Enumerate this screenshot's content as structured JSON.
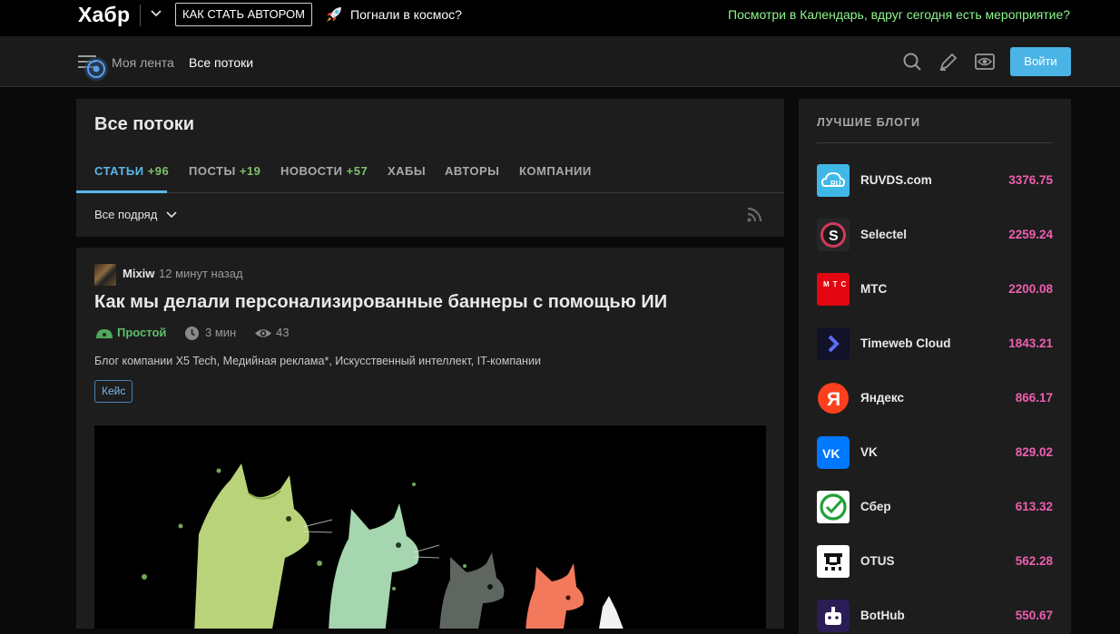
{
  "topbar": {
    "logo": "Хабр",
    "author_button": "КАК СТАТЬ АВТОРОМ",
    "space_link": "Погнали в космос?",
    "calendar_link": "Посмотри в Календарь, вдруг сегодня есть мероприятие?"
  },
  "nav": {
    "my_feed": "Моя лента",
    "all_streams": "Все потоки",
    "login": "Войти"
  },
  "page": {
    "title": "Все потоки",
    "tabs": [
      {
        "label": "СТАТЬИ",
        "count": "+96"
      },
      {
        "label": "ПОСТЫ",
        "count": "+19"
      },
      {
        "label": "НОВОСТИ",
        "count": "+57"
      },
      {
        "label": "ХАБЫ",
        "count": ""
      },
      {
        "label": "АВТОРЫ",
        "count": ""
      },
      {
        "label": "КОМПАНИИ",
        "count": ""
      }
    ],
    "filter": "Все подряд"
  },
  "article": {
    "author": "Mixiw",
    "time": "12 минут назад",
    "title": "Как мы делали персонализированные баннеры с помощью ИИ",
    "difficulty": "Простой",
    "read_time": "3 мин",
    "views": "43",
    "hubs": "Блог компании X5 Tech, Медийная реклама*, Искусственный интеллект, IT-компании",
    "tag": "Кейс"
  },
  "sidebar": {
    "title": "ЛУЧШИЕ БЛОГИ",
    "blogs": [
      {
        "name": "RUVDS.com",
        "score": "3376.75",
        "logo_text": "RU"
      },
      {
        "name": "Selectel",
        "score": "2259.24",
        "logo_text": "S"
      },
      {
        "name": "МТС",
        "score": "2200.08",
        "logo_text": "МТС"
      },
      {
        "name": "Timeweb Cloud",
        "score": "1843.21",
        "logo_text": ">"
      },
      {
        "name": "Яндекс",
        "score": "866.17",
        "logo_text": "Я"
      },
      {
        "name": "VK",
        "score": "829.02",
        "logo_text": "VK"
      },
      {
        "name": "Сбер",
        "score": "613.32",
        "logo_text": ""
      },
      {
        "name": "OTUS",
        "score": "562.28",
        "logo_text": ""
      },
      {
        "name": "BotHub",
        "score": "550.67",
        "logo_text": ""
      }
    ]
  },
  "colors": {
    "accent": "#4ab4e6",
    "tab_count": "#7ec16a",
    "score": "#ee5fb0",
    "calendar": "#8ef58e"
  }
}
